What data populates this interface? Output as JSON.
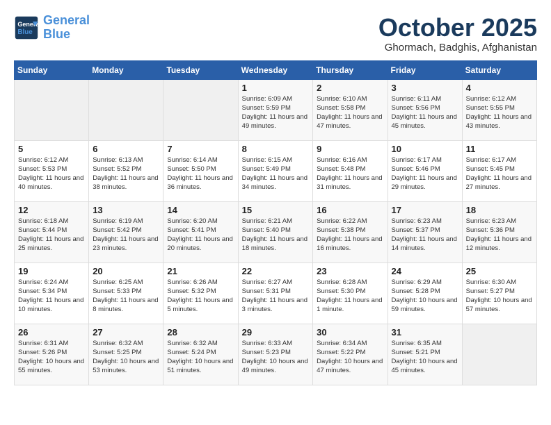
{
  "header": {
    "logo_line1": "General",
    "logo_line2": "Blue",
    "month": "October 2025",
    "location": "Ghormach, Badghis, Afghanistan"
  },
  "days_of_week": [
    "Sunday",
    "Monday",
    "Tuesday",
    "Wednesday",
    "Thursday",
    "Friday",
    "Saturday"
  ],
  "weeks": [
    [
      {
        "day": "",
        "info": ""
      },
      {
        "day": "",
        "info": ""
      },
      {
        "day": "",
        "info": ""
      },
      {
        "day": "1",
        "info": "Sunrise: 6:09 AM\nSunset: 5:59 PM\nDaylight: 11 hours and 49 minutes."
      },
      {
        "day": "2",
        "info": "Sunrise: 6:10 AM\nSunset: 5:58 PM\nDaylight: 11 hours and 47 minutes."
      },
      {
        "day": "3",
        "info": "Sunrise: 6:11 AM\nSunset: 5:56 PM\nDaylight: 11 hours and 45 minutes."
      },
      {
        "day": "4",
        "info": "Sunrise: 6:12 AM\nSunset: 5:55 PM\nDaylight: 11 hours and 43 minutes."
      }
    ],
    [
      {
        "day": "5",
        "info": "Sunrise: 6:12 AM\nSunset: 5:53 PM\nDaylight: 11 hours and 40 minutes."
      },
      {
        "day": "6",
        "info": "Sunrise: 6:13 AM\nSunset: 5:52 PM\nDaylight: 11 hours and 38 minutes."
      },
      {
        "day": "7",
        "info": "Sunrise: 6:14 AM\nSunset: 5:50 PM\nDaylight: 11 hours and 36 minutes."
      },
      {
        "day": "8",
        "info": "Sunrise: 6:15 AM\nSunset: 5:49 PM\nDaylight: 11 hours and 34 minutes."
      },
      {
        "day": "9",
        "info": "Sunrise: 6:16 AM\nSunset: 5:48 PM\nDaylight: 11 hours and 31 minutes."
      },
      {
        "day": "10",
        "info": "Sunrise: 6:17 AM\nSunset: 5:46 PM\nDaylight: 11 hours and 29 minutes."
      },
      {
        "day": "11",
        "info": "Sunrise: 6:17 AM\nSunset: 5:45 PM\nDaylight: 11 hours and 27 minutes."
      }
    ],
    [
      {
        "day": "12",
        "info": "Sunrise: 6:18 AM\nSunset: 5:44 PM\nDaylight: 11 hours and 25 minutes."
      },
      {
        "day": "13",
        "info": "Sunrise: 6:19 AM\nSunset: 5:42 PM\nDaylight: 11 hours and 23 minutes."
      },
      {
        "day": "14",
        "info": "Sunrise: 6:20 AM\nSunset: 5:41 PM\nDaylight: 11 hours and 20 minutes."
      },
      {
        "day": "15",
        "info": "Sunrise: 6:21 AM\nSunset: 5:40 PM\nDaylight: 11 hours and 18 minutes."
      },
      {
        "day": "16",
        "info": "Sunrise: 6:22 AM\nSunset: 5:38 PM\nDaylight: 11 hours and 16 minutes."
      },
      {
        "day": "17",
        "info": "Sunrise: 6:23 AM\nSunset: 5:37 PM\nDaylight: 11 hours and 14 minutes."
      },
      {
        "day": "18",
        "info": "Sunrise: 6:23 AM\nSunset: 5:36 PM\nDaylight: 11 hours and 12 minutes."
      }
    ],
    [
      {
        "day": "19",
        "info": "Sunrise: 6:24 AM\nSunset: 5:34 PM\nDaylight: 11 hours and 10 minutes."
      },
      {
        "day": "20",
        "info": "Sunrise: 6:25 AM\nSunset: 5:33 PM\nDaylight: 11 hours and 8 minutes."
      },
      {
        "day": "21",
        "info": "Sunrise: 6:26 AM\nSunset: 5:32 PM\nDaylight: 11 hours and 5 minutes."
      },
      {
        "day": "22",
        "info": "Sunrise: 6:27 AM\nSunset: 5:31 PM\nDaylight: 11 hours and 3 minutes."
      },
      {
        "day": "23",
        "info": "Sunrise: 6:28 AM\nSunset: 5:30 PM\nDaylight: 11 hours and 1 minute."
      },
      {
        "day": "24",
        "info": "Sunrise: 6:29 AM\nSunset: 5:28 PM\nDaylight: 10 hours and 59 minutes."
      },
      {
        "day": "25",
        "info": "Sunrise: 6:30 AM\nSunset: 5:27 PM\nDaylight: 10 hours and 57 minutes."
      }
    ],
    [
      {
        "day": "26",
        "info": "Sunrise: 6:31 AM\nSunset: 5:26 PM\nDaylight: 10 hours and 55 minutes."
      },
      {
        "day": "27",
        "info": "Sunrise: 6:32 AM\nSunset: 5:25 PM\nDaylight: 10 hours and 53 minutes."
      },
      {
        "day": "28",
        "info": "Sunrise: 6:32 AM\nSunset: 5:24 PM\nDaylight: 10 hours and 51 minutes."
      },
      {
        "day": "29",
        "info": "Sunrise: 6:33 AM\nSunset: 5:23 PM\nDaylight: 10 hours and 49 minutes."
      },
      {
        "day": "30",
        "info": "Sunrise: 6:34 AM\nSunset: 5:22 PM\nDaylight: 10 hours and 47 minutes."
      },
      {
        "day": "31",
        "info": "Sunrise: 6:35 AM\nSunset: 5:21 PM\nDaylight: 10 hours and 45 minutes."
      },
      {
        "day": "",
        "info": ""
      }
    ]
  ]
}
